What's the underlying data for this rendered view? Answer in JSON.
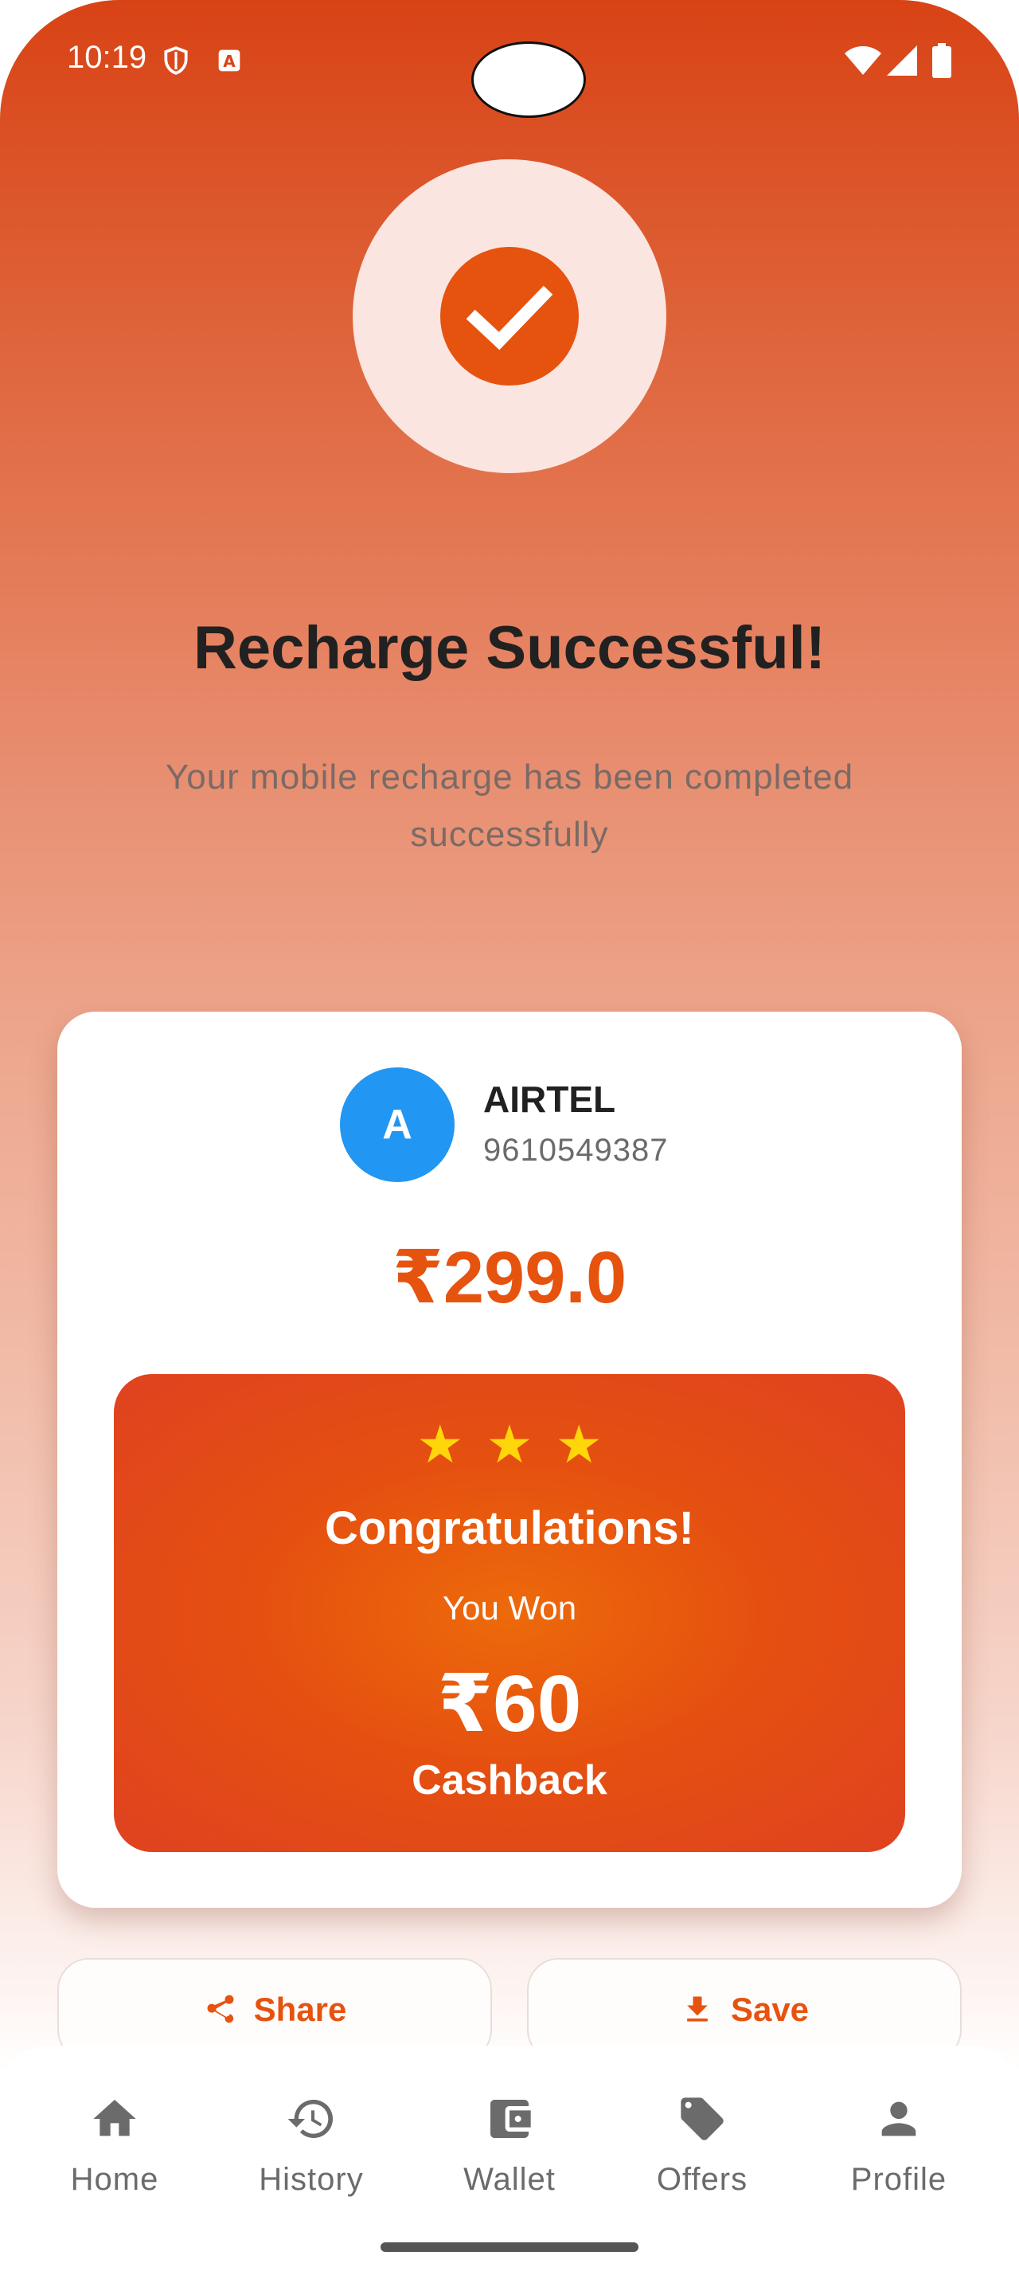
{
  "status_bar": {
    "time": "10:19",
    "left_icons": [
      "shield-icon",
      "a-app-icon"
    ],
    "right_icons": [
      "wifi-icon",
      "signal-icon",
      "battery-icon"
    ]
  },
  "success": {
    "icon": "check-icon",
    "title": "Recharge Successful!",
    "subtitle": "Your mobile recharge has been completed successfully"
  },
  "recharge": {
    "avatar_letter": "A",
    "avatar_color": "#2196F3",
    "operator": "AIRTEL",
    "phone": "9610549387",
    "amount": "₹299.0"
  },
  "reward": {
    "stars": "★★★",
    "title": "Congratulations!",
    "you_won": "You Won",
    "amount": "₹60",
    "label": "Cashback"
  },
  "actions": {
    "share_label": "Share",
    "save_label": "Save"
  },
  "bottom_nav": {
    "items": [
      {
        "label": "Home",
        "icon": "home-icon"
      },
      {
        "label": "History",
        "icon": "history-icon"
      },
      {
        "label": "Wallet",
        "icon": "wallet-icon"
      },
      {
        "label": "Offers",
        "icon": "tag-icon"
      },
      {
        "label": "Profile",
        "icon": "person-icon"
      }
    ]
  },
  "colors": {
    "accent": "#E6530F",
    "header_gradient_top": "#D84315",
    "star": "#FFD60A",
    "title_text": "#212121"
  }
}
